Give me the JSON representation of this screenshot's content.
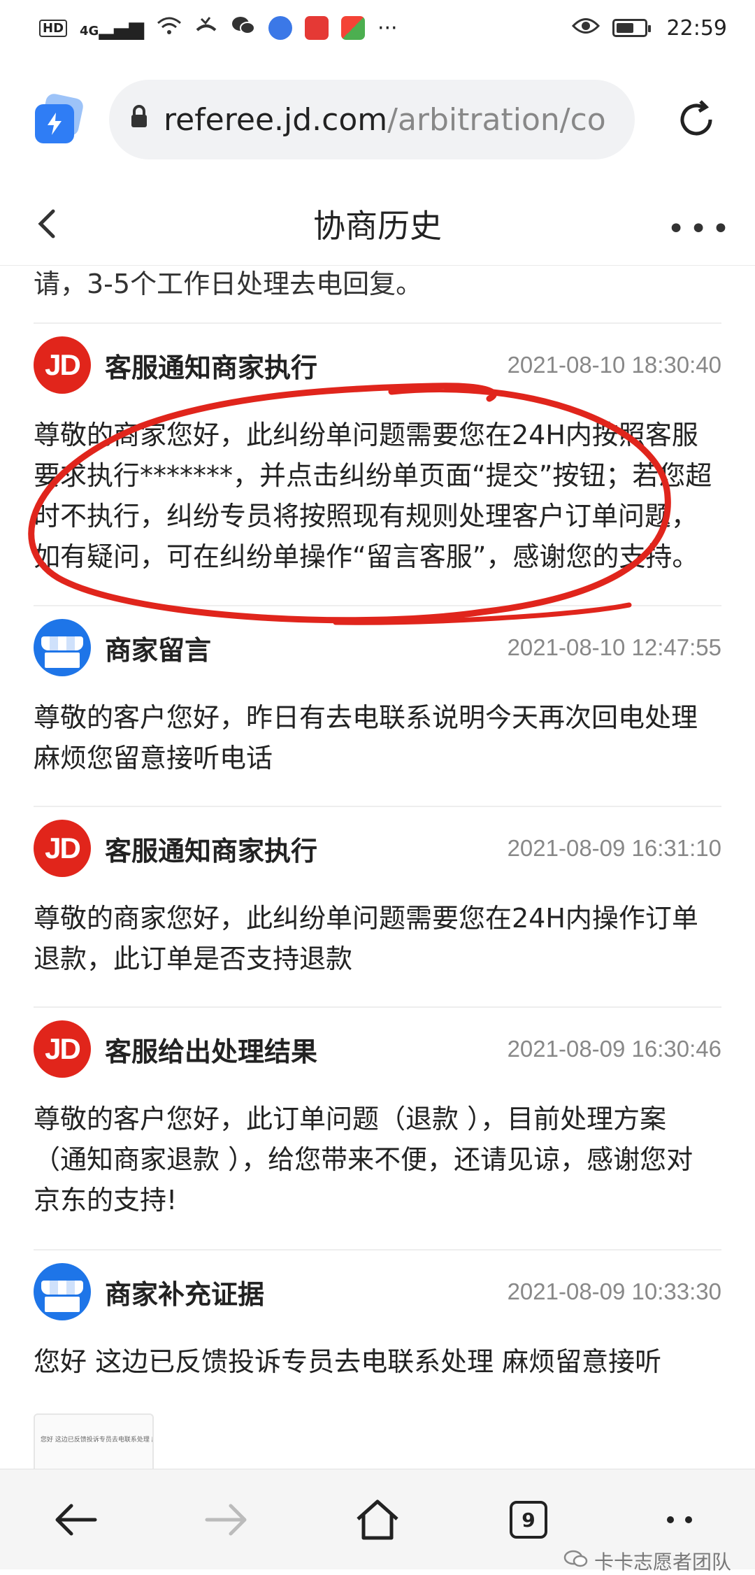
{
  "status_bar": {
    "hd": "HD",
    "network": "4G",
    "more": "···",
    "time": "22:59"
  },
  "browser": {
    "url_domain": "referee.jd.com",
    "url_path": "/arbitration/co",
    "lock_icon": "lock-icon",
    "reload_icon": "reload-icon"
  },
  "header": {
    "title": "协商历史",
    "back_icon": "chevron-left-icon",
    "more_icon": "more-icon"
  },
  "partial_top_text": "请，3-5个工作日处理去电回复。",
  "entries": [
    {
      "avatar": "jd-logo",
      "avatar_text": "JD",
      "title": "客服通知商家执行",
      "time": "2021-08-10 18:30:40",
      "lines": [
        "尊敬的商家您好，此纠纷单问题需要您在24H内按照客服",
        "要求执行*******，并点击纠纷单页面“提交”按钮；若您超",
        "时不执行，纠纷专员将按照现有规则处理客户订单问题，",
        "如有疑问，可在纠纷单操作“留言客服”，感谢您的支持。"
      ]
    },
    {
      "avatar": "shop-icon",
      "title": "商家留言",
      "time": "2021-08-10 12:47:55",
      "lines": [
        "尊敬的客户您好，昨日有去电联系说明今天再次回电处理",
        "麻烦您留意接听电话"
      ]
    },
    {
      "avatar": "jd-logo",
      "avatar_text": "JD",
      "title": "客服通知商家执行",
      "time": "2021-08-09 16:31:10",
      "lines": [
        "尊敬的商家您好，此纠纷单问题需要您在24H内操作订单",
        "退款，此订单是否支持退款"
      ]
    },
    {
      "avatar": "jd-logo",
      "avatar_text": "JD",
      "title": "客服给出处理结果",
      "time": "2021-08-09 16:30:46",
      "lines": [
        "尊敬的客户您好，此订单问题（退款 ），目前处理方案",
        "（通知商家退款 ），给您带来不便，还请见谅，感谢您对",
        "京东的支持!"
      ]
    },
    {
      "avatar": "shop-icon",
      "title": "商家补充证据",
      "time": "2021-08-09 10:33:30",
      "lines": [
        "您好 这边已反馈投诉专员去电联系处理 麻烦留意接听"
      ]
    }
  ],
  "evidence_thumbnail_text": "您好 这边已反馈投诉专员去电联系处理 麻烦留意接听",
  "bottom_nav": {
    "back_icon": "arrow-left-icon",
    "forward_icon": "arrow-right-icon",
    "home_icon": "home-icon",
    "tab_count": "9",
    "menu_icon": "menu-dots-icon"
  },
  "watermark": "卡卡志愿者团队",
  "colors": {
    "jd_red": "#e1251b",
    "shop_blue": "#1e75e8",
    "annotation_red": "#e0251c",
    "time_gray": "#888888"
  }
}
